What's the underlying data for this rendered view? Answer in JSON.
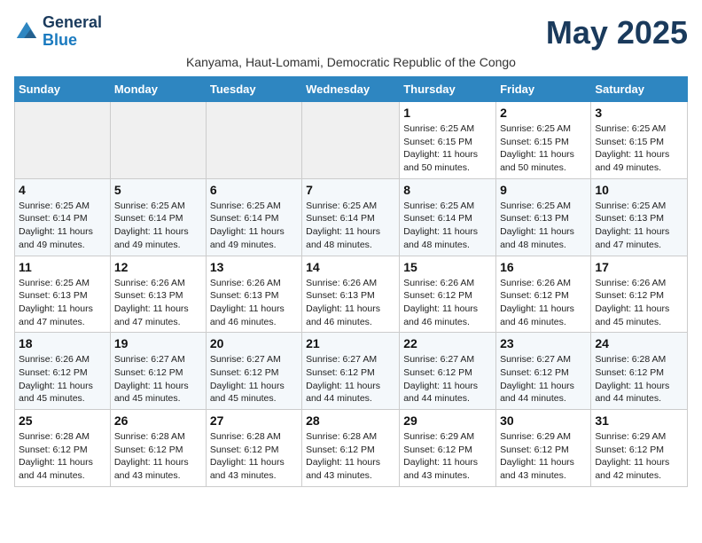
{
  "header": {
    "logo_general": "General",
    "logo_blue": "Blue",
    "month_title": "May 2025",
    "subtitle": "Kanyama, Haut-Lomami, Democratic Republic of the Congo"
  },
  "days_of_week": [
    "Sunday",
    "Monday",
    "Tuesday",
    "Wednesday",
    "Thursday",
    "Friday",
    "Saturday"
  ],
  "weeks": [
    [
      {
        "day": "",
        "info": ""
      },
      {
        "day": "",
        "info": ""
      },
      {
        "day": "",
        "info": ""
      },
      {
        "day": "",
        "info": ""
      },
      {
        "day": "1",
        "info": "Sunrise: 6:25 AM\nSunset: 6:15 PM\nDaylight: 11 hours and 50 minutes."
      },
      {
        "day": "2",
        "info": "Sunrise: 6:25 AM\nSunset: 6:15 PM\nDaylight: 11 hours and 50 minutes."
      },
      {
        "day": "3",
        "info": "Sunrise: 6:25 AM\nSunset: 6:15 PM\nDaylight: 11 hours and 49 minutes."
      }
    ],
    [
      {
        "day": "4",
        "info": "Sunrise: 6:25 AM\nSunset: 6:14 PM\nDaylight: 11 hours and 49 minutes."
      },
      {
        "day": "5",
        "info": "Sunrise: 6:25 AM\nSunset: 6:14 PM\nDaylight: 11 hours and 49 minutes."
      },
      {
        "day": "6",
        "info": "Sunrise: 6:25 AM\nSunset: 6:14 PM\nDaylight: 11 hours and 49 minutes."
      },
      {
        "day": "7",
        "info": "Sunrise: 6:25 AM\nSunset: 6:14 PM\nDaylight: 11 hours and 48 minutes."
      },
      {
        "day": "8",
        "info": "Sunrise: 6:25 AM\nSunset: 6:14 PM\nDaylight: 11 hours and 48 minutes."
      },
      {
        "day": "9",
        "info": "Sunrise: 6:25 AM\nSunset: 6:13 PM\nDaylight: 11 hours and 48 minutes."
      },
      {
        "day": "10",
        "info": "Sunrise: 6:25 AM\nSunset: 6:13 PM\nDaylight: 11 hours and 47 minutes."
      }
    ],
    [
      {
        "day": "11",
        "info": "Sunrise: 6:25 AM\nSunset: 6:13 PM\nDaylight: 11 hours and 47 minutes."
      },
      {
        "day": "12",
        "info": "Sunrise: 6:26 AM\nSunset: 6:13 PM\nDaylight: 11 hours and 47 minutes."
      },
      {
        "day": "13",
        "info": "Sunrise: 6:26 AM\nSunset: 6:13 PM\nDaylight: 11 hours and 46 minutes."
      },
      {
        "day": "14",
        "info": "Sunrise: 6:26 AM\nSunset: 6:13 PM\nDaylight: 11 hours and 46 minutes."
      },
      {
        "day": "15",
        "info": "Sunrise: 6:26 AM\nSunset: 6:12 PM\nDaylight: 11 hours and 46 minutes."
      },
      {
        "day": "16",
        "info": "Sunrise: 6:26 AM\nSunset: 6:12 PM\nDaylight: 11 hours and 46 minutes."
      },
      {
        "day": "17",
        "info": "Sunrise: 6:26 AM\nSunset: 6:12 PM\nDaylight: 11 hours and 45 minutes."
      }
    ],
    [
      {
        "day": "18",
        "info": "Sunrise: 6:26 AM\nSunset: 6:12 PM\nDaylight: 11 hours and 45 minutes."
      },
      {
        "day": "19",
        "info": "Sunrise: 6:27 AM\nSunset: 6:12 PM\nDaylight: 11 hours and 45 minutes."
      },
      {
        "day": "20",
        "info": "Sunrise: 6:27 AM\nSunset: 6:12 PM\nDaylight: 11 hours and 45 minutes."
      },
      {
        "day": "21",
        "info": "Sunrise: 6:27 AM\nSunset: 6:12 PM\nDaylight: 11 hours and 44 minutes."
      },
      {
        "day": "22",
        "info": "Sunrise: 6:27 AM\nSunset: 6:12 PM\nDaylight: 11 hours and 44 minutes."
      },
      {
        "day": "23",
        "info": "Sunrise: 6:27 AM\nSunset: 6:12 PM\nDaylight: 11 hours and 44 minutes."
      },
      {
        "day": "24",
        "info": "Sunrise: 6:28 AM\nSunset: 6:12 PM\nDaylight: 11 hours and 44 minutes."
      }
    ],
    [
      {
        "day": "25",
        "info": "Sunrise: 6:28 AM\nSunset: 6:12 PM\nDaylight: 11 hours and 44 minutes."
      },
      {
        "day": "26",
        "info": "Sunrise: 6:28 AM\nSunset: 6:12 PM\nDaylight: 11 hours and 43 minutes."
      },
      {
        "day": "27",
        "info": "Sunrise: 6:28 AM\nSunset: 6:12 PM\nDaylight: 11 hours and 43 minutes."
      },
      {
        "day": "28",
        "info": "Sunrise: 6:28 AM\nSunset: 6:12 PM\nDaylight: 11 hours and 43 minutes."
      },
      {
        "day": "29",
        "info": "Sunrise: 6:29 AM\nSunset: 6:12 PM\nDaylight: 11 hours and 43 minutes."
      },
      {
        "day": "30",
        "info": "Sunrise: 6:29 AM\nSunset: 6:12 PM\nDaylight: 11 hours and 43 minutes."
      },
      {
        "day": "31",
        "info": "Sunrise: 6:29 AM\nSunset: 6:12 PM\nDaylight: 11 hours and 42 minutes."
      }
    ]
  ]
}
